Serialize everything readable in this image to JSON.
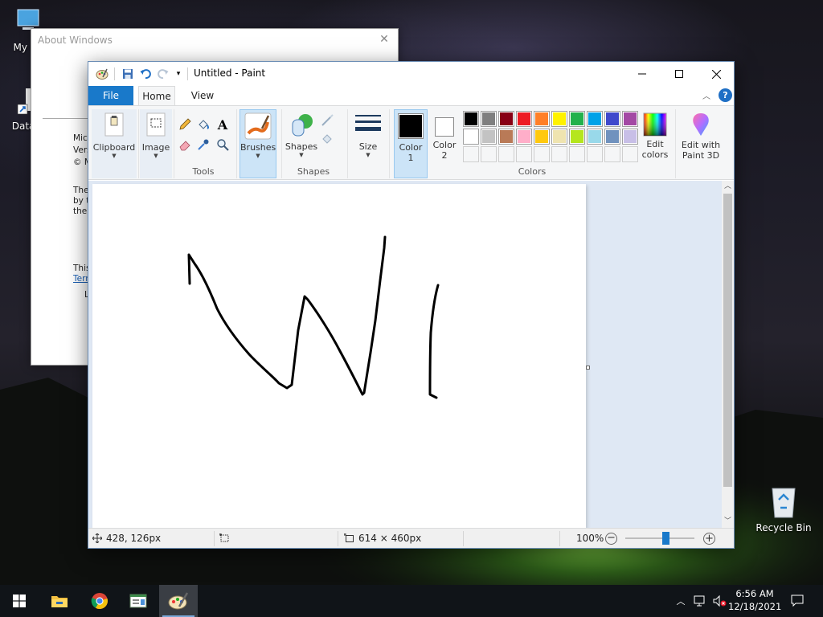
{
  "desktop": {
    "icons": [
      {
        "label": "My Co",
        "icon": "computer-icon"
      },
      {
        "label": "DataW",
        "icon": "shortcut-icon"
      },
      {
        "label": "Recycle Bin",
        "icon": "recycle-bin-icon"
      }
    ]
  },
  "about_window": {
    "title": "About Windows",
    "lines": [
      "Micr",
      "Vers",
      "© M",
      "The",
      "by t",
      "the",
      "This",
      "Tern",
      "L"
    ]
  },
  "paint": {
    "title": "Untitled - Paint",
    "tabs": {
      "file": "File",
      "home": "Home",
      "view": "View"
    },
    "ribbon": {
      "clipboard": "Clipboard",
      "image": "Image",
      "tools_group": "Tools",
      "brushes": "Brushes",
      "shapes": "Shapes",
      "shapes_group": "Shapes",
      "size": "Size",
      "color1_line1": "Color",
      "color1_line2": "1",
      "color2_line1": "Color",
      "color2_line2": "2",
      "edit_colors_line1": "Edit",
      "edit_colors_line2": "colors",
      "paint3d_line1": "Edit with",
      "paint3d_line2": "Paint 3D",
      "colors_group": "Colors",
      "color1_value": "#000000",
      "color2_value": "#ffffff"
    },
    "palette": {
      "row1": [
        "#000000",
        "#7f7f7f",
        "#880015",
        "#ed1c24",
        "#ff7f27",
        "#fff200",
        "#22b14c",
        "#00a2e8",
        "#3f48cc",
        "#a349a4"
      ],
      "row2": [
        "#ffffff",
        "#c3c3c3",
        "#b97a57",
        "#ffaec9",
        "#ffc90e",
        "#efe4b0",
        "#b5e61d",
        "#99d9ea",
        "#7092be",
        "#c8bfe7"
      ],
      "row3": [
        "",
        "",
        "",
        "",
        "",
        "",
        "",
        "",
        "",
        ""
      ]
    },
    "status": {
      "cursor_pos": "428, 126px",
      "canvas_size": "614 × 460px",
      "zoom": "100%",
      "zoom_level": 0.6
    }
  },
  "taskbar": {
    "apps": [
      "start-icon",
      "file-explorer-icon",
      "chrome-icon",
      "app-window-icon",
      "paint-icon"
    ],
    "time": "6:56 AM",
    "date": "12/18/2021"
  }
}
